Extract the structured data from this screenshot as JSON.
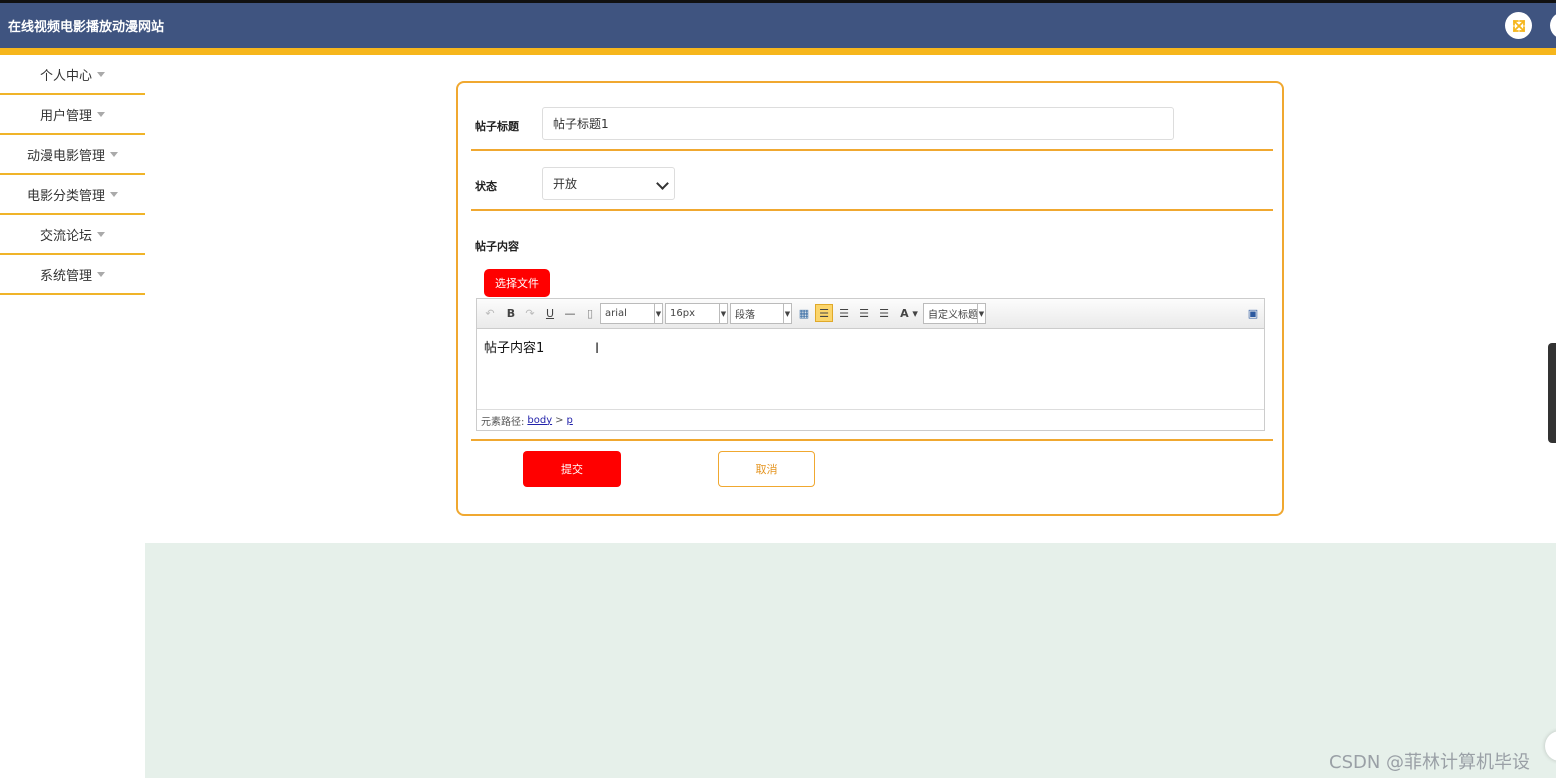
{
  "header": {
    "title": "在线视频电影播放动漫网站",
    "fullscreen_icon": "expand-arrows-icon",
    "accent_color": "#f6b61c",
    "bar_color": "#3f5480"
  },
  "sidebar": {
    "items": [
      {
        "label": "个人中心"
      },
      {
        "label": "用户管理"
      },
      {
        "label": "动漫电影管理"
      },
      {
        "label": "电影分类管理"
      },
      {
        "label": "交流论坛"
      },
      {
        "label": "系统管理"
      }
    ]
  },
  "form": {
    "title_label": "帖子标题",
    "title_value": "帖子标题1",
    "status_label": "状态",
    "status_value": "开放",
    "content_label": "帖子内容",
    "file_button": "选择文件",
    "editor": {
      "font_family": "arial",
      "font_size": "16px",
      "paragraph": "段落",
      "custom_heading": "自定义标题",
      "content": "帖子内容1",
      "path_label": "元素路径:",
      "path_body": "body",
      "path_sep": ">",
      "path_p": "p"
    },
    "submit_label": "提交",
    "cancel_label": "取消"
  },
  "watermark": "CSDN @菲林计算机毕设"
}
